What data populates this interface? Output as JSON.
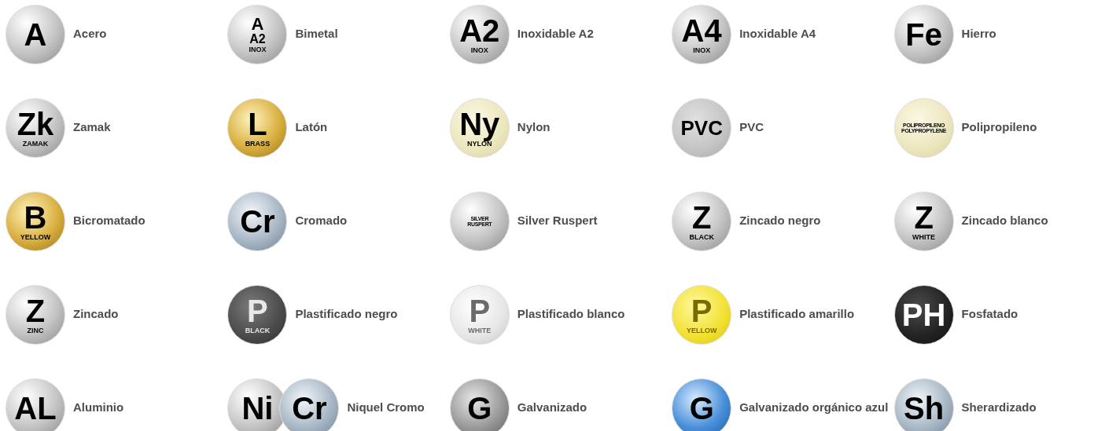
{
  "materials": [
    {
      "label": "Acero",
      "badges": [
        {
          "kind": "silver",
          "lines": [
            "A"
          ]
        }
      ]
    },
    {
      "label": "Bimetal",
      "badges": [
        {
          "kind": "silver",
          "lines": [
            "A",
            "A2",
            "INOX"
          ]
        }
      ]
    },
    {
      "label": "Inoxidable A2",
      "badges": [
        {
          "kind": "silver",
          "lines": [
            "A2",
            "INOX"
          ]
        }
      ]
    },
    {
      "label": "Inoxidable A4",
      "badges": [
        {
          "kind": "silver",
          "lines": [
            "A4",
            "INOX"
          ]
        }
      ]
    },
    {
      "label": "Hierro",
      "badges": [
        {
          "kind": "silver",
          "lines": [
            "Fe"
          ]
        }
      ]
    },
    {
      "label": "Zamak",
      "badges": [
        {
          "kind": "silver",
          "lines": [
            "Zk",
            "ZAMAK"
          ]
        }
      ]
    },
    {
      "label": "Latón",
      "badges": [
        {
          "kind": "gold",
          "lines": [
            "L",
            "BRASS"
          ]
        }
      ]
    },
    {
      "label": "Nylon",
      "badges": [
        {
          "kind": "cream",
          "lines": [
            "Ny",
            "NYLON"
          ]
        }
      ]
    },
    {
      "label": "PVC",
      "badges": [
        {
          "kind": "grey",
          "lines": [
            "PVC"
          ]
        }
      ]
    },
    {
      "label": "Polipropileno",
      "badges": [
        {
          "kind": "cream",
          "lines": [
            "POLIPROPILENO",
            "POLYPROPYLENE"
          ]
        }
      ]
    },
    {
      "label": "Bicromatado",
      "badges": [
        {
          "kind": "gold",
          "lines": [
            "B",
            "YELLOW"
          ]
        }
      ]
    },
    {
      "label": "Cromado",
      "badges": [
        {
          "kind": "steel",
          "lines": [
            "Cr"
          ]
        }
      ]
    },
    {
      "label": "Silver Ruspert",
      "badges": [
        {
          "kind": "silver",
          "lines": [
            "SILVER",
            "RUSPERT"
          ]
        }
      ]
    },
    {
      "label": "Zincado negro",
      "badges": [
        {
          "kind": "silver",
          "lines": [
            "Z",
            "BLACK"
          ]
        }
      ]
    },
    {
      "label": "Zincado blanco",
      "badges": [
        {
          "kind": "silver",
          "lines": [
            "Z",
            "WHITE"
          ]
        }
      ]
    },
    {
      "label": "Zincado",
      "badges": [
        {
          "kind": "silver",
          "lines": [
            "Z",
            "ZINC"
          ]
        }
      ]
    },
    {
      "label": "Plastificado negro",
      "badges": [
        {
          "kind": "darkgrey",
          "lines": [
            "P",
            "BLACK"
          ]
        }
      ]
    },
    {
      "label": "Plastificado blanco",
      "badges": [
        {
          "kind": "white",
          "lines": [
            "P",
            "WHITE"
          ]
        }
      ]
    },
    {
      "label": "Plastificado amarillo",
      "badges": [
        {
          "kind": "yellow",
          "lines": [
            "P",
            "YELLOW"
          ]
        }
      ]
    },
    {
      "label": "Fosfatado",
      "badges": [
        {
          "kind": "black",
          "lines": [
            "PH"
          ]
        }
      ]
    },
    {
      "label": "Aluminio",
      "badges": [
        {
          "kind": "silver",
          "lines": [
            "AL"
          ]
        }
      ]
    },
    {
      "label": "Niquel Cromo",
      "badges": [
        {
          "kind": "silver",
          "lines": [
            "Ni"
          ]
        },
        {
          "kind": "steel",
          "lines": [
            "Cr"
          ]
        }
      ]
    },
    {
      "label": "Galvanizado",
      "badges": [
        {
          "kind": "darksilver",
          "lines": [
            "G"
          ]
        }
      ]
    },
    {
      "label": "Galvanizado orgánico azul",
      "badges": [
        {
          "kind": "blue",
          "lines": [
            "G"
          ]
        }
      ]
    },
    {
      "label": "Sherardizado",
      "badges": [
        {
          "kind": "steel",
          "lines": [
            "Sh"
          ]
        }
      ]
    }
  ]
}
